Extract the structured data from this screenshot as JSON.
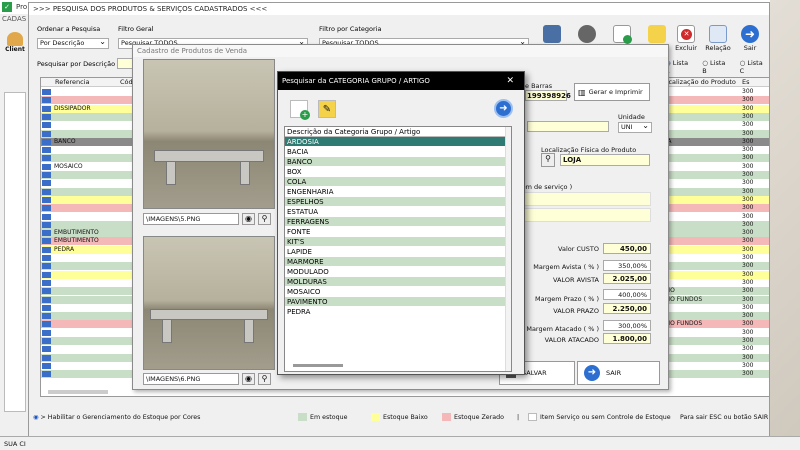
{
  "app": {
    "title": "Pro",
    "bg_title": "CADAS",
    "left_icon_label": "Client"
  },
  "search": {
    "title": "PESQUISA DOS PRODUTOS & SERVIÇOS CADASTRADOS",
    "ordenar_label": "Ordenar a Pesquisa",
    "ordenar_value": "Por Descrição",
    "filtro_geral_label": "Filtro Geral",
    "filtro_geral_value": "Pesquisar TODOS",
    "filtro_cat_label": "Filtro por Categoria",
    "filtro_cat_value": "Pesquisar TODOS",
    "pesquisar_label": "Pesquisar por Descrição",
    "toolbar": {
      "excluir": "Excluir",
      "relacao": "Relação",
      "sair": "Sair"
    },
    "lista": [
      "Lista A",
      "Lista B",
      "Lista C"
    ],
    "columns": {
      "ref": "Referencia",
      "cod": "Cód",
      "loc": "Localização do Produto",
      "e": "Es"
    },
    "rows": [
      {
        "text": "",
        "color": "#ffffff",
        "loc": "",
        "e": "300"
      },
      {
        "text": "",
        "color": "#f4b8b8",
        "loc": "",
        "e": "300"
      },
      {
        "text": "DISSIPADOR",
        "color": "#ffff9a",
        "loc": "",
        "e": "300"
      },
      {
        "text": "",
        "color": "#c8dec6",
        "loc": "",
        "e": "300"
      },
      {
        "text": "",
        "color": "#ffffff",
        "loc": "",
        "e": "300"
      },
      {
        "text": "",
        "color": "#c8dec6",
        "loc": "",
        "e": "300"
      },
      {
        "text": "BANCO",
        "color": "#8a8a8a",
        "loc": "OJA",
        "e": "300"
      },
      {
        "text": "",
        "color": "#ffffff",
        "loc": "",
        "e": "300"
      },
      {
        "text": "",
        "color": "#c8dec6",
        "loc": "",
        "e": "300"
      },
      {
        "text": "MOSAICO",
        "color": "#ffffff",
        "loc": "",
        "e": "300"
      },
      {
        "text": "",
        "color": "#c8dec6",
        "loc": "",
        "e": "300"
      },
      {
        "text": "",
        "color": "#ffffff",
        "loc": "",
        "e": "300"
      },
      {
        "text": "",
        "color": "#c8dec6",
        "loc": "",
        "e": "300"
      },
      {
        "text": "",
        "color": "#ffff9a",
        "loc": "",
        "e": "300"
      },
      {
        "text": "",
        "color": "#f4b8b8",
        "loc": "",
        "e": "300"
      },
      {
        "text": "",
        "color": "#ffffff",
        "loc": "",
        "e": "300"
      },
      {
        "text": "",
        "color": "#c8dec6",
        "loc": "",
        "e": "300"
      },
      {
        "text": "EMBUTIMENTO",
        "color": "#c8dec6",
        "loc": "",
        "e": "300"
      },
      {
        "text": "EMBUTIMENTO",
        "color": "#f4b8b8",
        "loc": "",
        "e": "300"
      },
      {
        "text": "PEDRA",
        "color": "#ffff9a",
        "loc": "",
        "e": "300"
      },
      {
        "text": "",
        "color": "#ffffff",
        "loc": "",
        "e": "300"
      },
      {
        "text": "",
        "color": "#c8dec6",
        "loc": "",
        "e": "300"
      },
      {
        "text": "",
        "color": "#ffff9a",
        "loc": "",
        "e": "300"
      },
      {
        "text": "",
        "color": "#ffffff",
        "loc": "",
        "e": "300"
      },
      {
        "text": "",
        "color": "#c8dec6",
        "loc": "ATIO",
        "e": "300"
      },
      {
        "text": "",
        "color": "#c8dec6",
        "loc": "ATIO FUNDOS",
        "e": "300"
      },
      {
        "text": "",
        "color": "#ffffff",
        "loc": "",
        "e": "300"
      },
      {
        "text": "",
        "color": "#c8dec6",
        "loc": "",
        "e": "300"
      },
      {
        "text": "",
        "color": "#f4b8b8",
        "loc": "ATIO FUNDOS",
        "e": "300"
      },
      {
        "text": "",
        "color": "#ffffff",
        "loc": "",
        "e": "300"
      },
      {
        "text": "",
        "color": "#c8dec6",
        "loc": "",
        "e": "300"
      },
      {
        "text": "",
        "color": "#ffffff",
        "loc": "",
        "e": "300"
      },
      {
        "text": "",
        "color": "#c8dec6",
        "loc": "",
        "e": "300"
      },
      {
        "text": "",
        "color": "#ffffff",
        "loc": "",
        "e": "300"
      },
      {
        "text": "",
        "color": "#c8dec6",
        "loc": "",
        "e": "300"
      }
    ]
  },
  "cadastro": {
    "title": "Cadastro de Produtos de Venda",
    "img1_path": "\\IMAGENS\\5.PNG",
    "img2_path": "\\IMAGENS\\6.PNG",
    "barras_label": "e Barras",
    "barras_value": "199398926",
    "gerar_btn": "Gerar e Imprimir",
    "unidade_label": "Unidade",
    "unidade_value": "UNI",
    "loc_label": "Localização Física do Produto",
    "loc_value": "LOJA",
    "ordem_label": "ordem de serviço )",
    "valor_custo_label": "Valor CUSTO",
    "valor_custo": "450,00",
    "margem_avista_label": "Margem Avista ( % )",
    "margem_avista": "350,00%",
    "valor_avista_label": "VALOR AVISTA",
    "valor_avista": "2.025,00",
    "margem_prazo_label": "Margem Prazo ( % )",
    "margem_prazo": "400,00%",
    "valor_prazo_label": "VALOR PRAZO",
    "valor_prazo": "2.250,00",
    "margem_atacado_label": "Margem Atacado ( % )",
    "margem_atacado": "300,00%",
    "valor_atacado_label": "VALOR ATACADO",
    "valor_atacado": "1.800,00",
    "salvar_btn": "SALVAR",
    "sair_btn": "SAIR"
  },
  "category": {
    "title": "Pesquisar da CATEGORIA GRUPO / ARTIGO",
    "close": "✕",
    "header": "Descrição da Categoria Grupo / Artigo",
    "items": [
      "ARDOSIA",
      "BACIA",
      "BANCO",
      "BOX",
      "COLA",
      "ENGENHARIA",
      "ESPELHOS",
      "ESTATUA",
      "FERRAGENS",
      "FONTE",
      "KIT'S",
      "LAPIDE",
      "MARMORE",
      "MODULADO",
      "MOLDURAS",
      "MOSAICO",
      "PAVIMENTO",
      "PEDRA"
    ]
  },
  "footer": {
    "estoque_hint": "> Habilitar o Gerenciamento do Estoque por Cores",
    "em_estoque": "Em estoque",
    "estoque_baixo": "Estoque Baixo",
    "estoque_zerado": "Estoque Zerado",
    "separator": "|",
    "item_servico": "Item Serviço ou sem Controle de Estoque",
    "sair_hint": "Para sair ESC ou botão SAIR",
    "colors": {
      "green": "#c8dec6",
      "yellow": "#ffff9a",
      "red": "#f4b8b8",
      "white": "#ffffff"
    }
  },
  "status": {
    "text": "SUA CI"
  }
}
